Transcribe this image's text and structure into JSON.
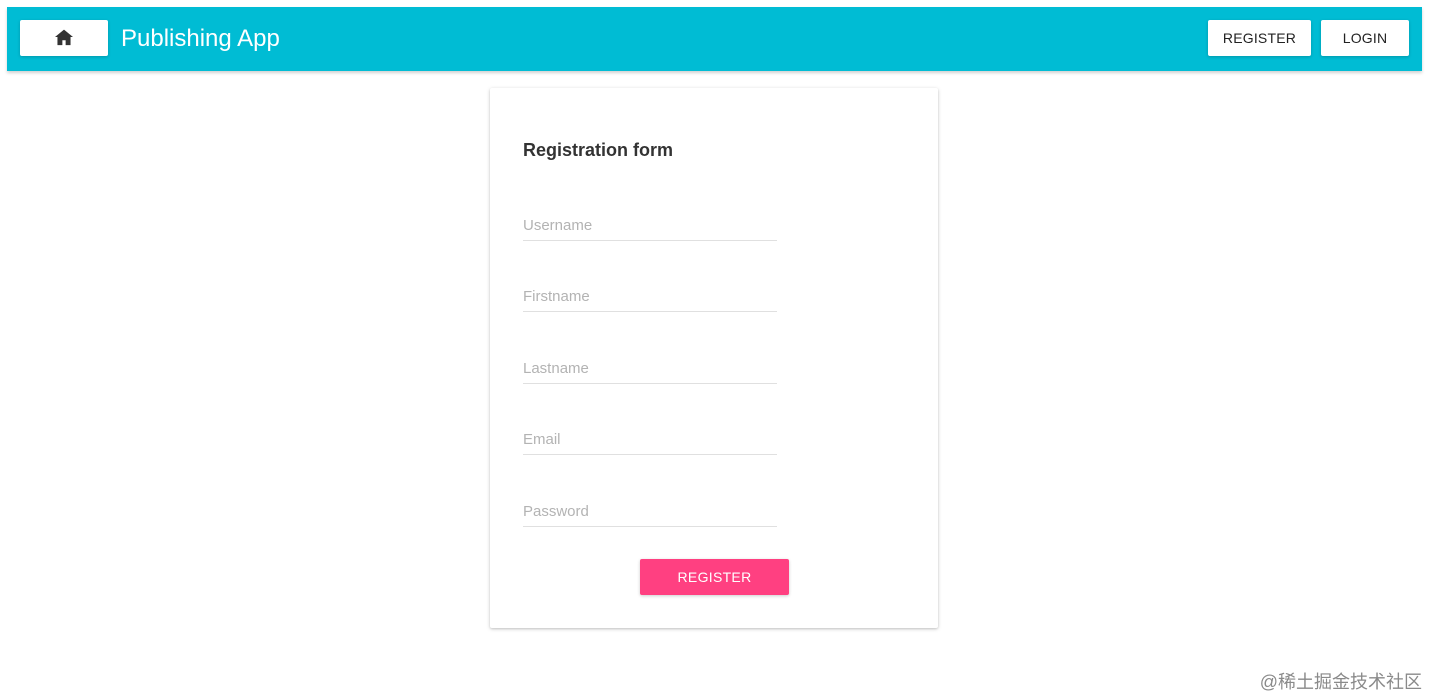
{
  "appbar": {
    "title": "Publishing App",
    "home_icon": "home-icon",
    "register_label": "REGISTER",
    "login_label": "LOGIN",
    "color": "#00bcd4"
  },
  "form": {
    "title": "Registration form",
    "fields": [
      {
        "name": "username",
        "placeholder": "Username",
        "value": ""
      },
      {
        "name": "firstname",
        "placeholder": "Firstname",
        "value": ""
      },
      {
        "name": "lastname",
        "placeholder": "Lastname",
        "value": ""
      },
      {
        "name": "email",
        "placeholder": "Email",
        "value": ""
      },
      {
        "name": "password",
        "placeholder": "Password",
        "value": ""
      }
    ],
    "submit_label": "REGISTER",
    "submit_color": "#ff4081"
  },
  "watermark": "@稀土掘金技术社区"
}
